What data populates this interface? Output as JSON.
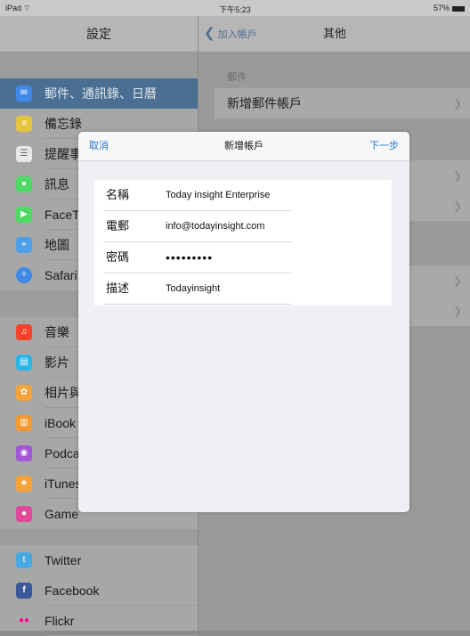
{
  "status": {
    "device": "iPad",
    "time": "下午5:23",
    "battery": "57%"
  },
  "sidebar": {
    "title": "設定",
    "items": [
      {
        "label": "郵件、通訊錄、日曆",
        "icon": "mail-icon",
        "color": "#3e88e6",
        "selected": true
      },
      {
        "label": "備忘錄",
        "icon": "notes-icon",
        "color": "#e6c43b"
      },
      {
        "label": "提醒事",
        "icon": "reminders-icon",
        "color": "#ffffff"
      },
      {
        "label": "訊息",
        "icon": "messages-icon",
        "color": "#4fd964"
      },
      {
        "label": "FaceT",
        "icon": "facetime-icon",
        "color": "#4fd964"
      },
      {
        "label": "地圖",
        "icon": "maps-icon",
        "color": "#4fa0e6"
      },
      {
        "label": "Safari",
        "icon": "safari-icon",
        "color": "#3e88e6"
      },
      {
        "label": "音樂",
        "icon": "music-icon",
        "color": "#f4422a"
      },
      {
        "label": "影片",
        "icon": "videos-icon",
        "color": "#2fb5e6"
      },
      {
        "label": "相片與",
        "icon": "photos-icon",
        "color": "#f2a33a"
      },
      {
        "label": "iBook",
        "icon": "ibooks-icon",
        "color": "#f29a2e"
      },
      {
        "label": "Podca",
        "icon": "podcasts-icon",
        "color": "#a256d8"
      },
      {
        "label": "iTunes",
        "icon": "itunes-icon",
        "color": "#f5a338"
      },
      {
        "label": "Game",
        "icon": "gamecenter-icon",
        "color": "#e04a9a"
      },
      {
        "label": "Twitter",
        "icon": "twitter-icon",
        "color": "#4aa8e0"
      },
      {
        "label": "Facebook",
        "icon": "facebook-icon",
        "color": "#3b5998"
      },
      {
        "label": "Flickr",
        "icon": "flickr-icon",
        "color": "#ff0084"
      }
    ]
  },
  "detail": {
    "back_label": "加入帳戶",
    "title": "其他",
    "section_mail": "郵件",
    "add_mail_account": "新增郵件帳戶"
  },
  "modal": {
    "cancel": "取消",
    "title": "新增帳戶",
    "next": "下一步",
    "fields": [
      {
        "label": "名稱",
        "value": "Today insight Enterprise"
      },
      {
        "label": "電郵",
        "value": "info@todayinsight.com"
      },
      {
        "label": "密碼",
        "value": "•••••••••"
      },
      {
        "label": "描述",
        "value": "Todayinsight"
      }
    ]
  }
}
